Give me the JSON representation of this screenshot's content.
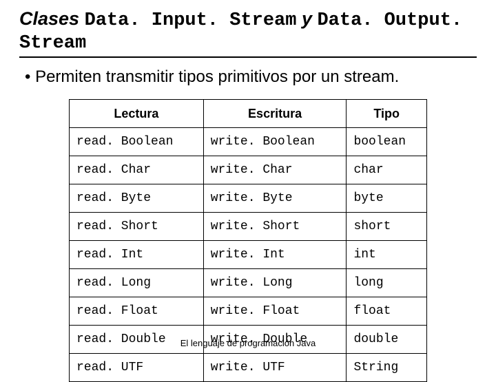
{
  "title": {
    "word_classes": "Clases ",
    "class1": "Data. Input. Stream",
    "word_y": " y ",
    "class2": "Data. Output. Stream"
  },
  "bullet": "Permiten transmitir tipos primitivos por un stream.",
  "table": {
    "headers": {
      "read": "Lectura",
      "write": "Escritura",
      "type": "Tipo"
    },
    "rows": [
      {
        "read": "read. Boolean",
        "write": "write. Boolean",
        "type": "boolean"
      },
      {
        "read": "read. Char",
        "write": "write. Char",
        "type": "char"
      },
      {
        "read": "read. Byte",
        "write": "write. Byte",
        "type": "byte"
      },
      {
        "read": "read. Short",
        "write": "write. Short",
        "type": "short"
      },
      {
        "read": "read. Int",
        "write": "write. Int",
        "type": "int"
      },
      {
        "read": "read. Long",
        "write": "write. Long",
        "type": "long"
      },
      {
        "read": "read. Float",
        "write": "write. Float",
        "type": "float"
      },
      {
        "read": "read. Double",
        "write": "write. Double",
        "type": "double"
      },
      {
        "read": "read. UTF",
        "write": "write. UTF",
        "type": "String"
      }
    ]
  },
  "footer": "El lenguaje de programación Java",
  "chart_data": {
    "type": "table",
    "title": "Clases Data.Input.Stream y Data.Output.Stream",
    "columns": [
      "Lectura",
      "Escritura",
      "Tipo"
    ],
    "rows": [
      [
        "read.Boolean",
        "write.Boolean",
        "boolean"
      ],
      [
        "read.Char",
        "write.Char",
        "char"
      ],
      [
        "read.Byte",
        "write.Byte",
        "byte"
      ],
      [
        "read.Short",
        "write.Short",
        "short"
      ],
      [
        "read.Int",
        "write.Int",
        "int"
      ],
      [
        "read.Long",
        "write.Long",
        "long"
      ],
      [
        "read.Float",
        "write.Float",
        "float"
      ],
      [
        "read.Double",
        "write.Double",
        "double"
      ],
      [
        "read.UTF",
        "write.UTF",
        "String"
      ]
    ]
  }
}
